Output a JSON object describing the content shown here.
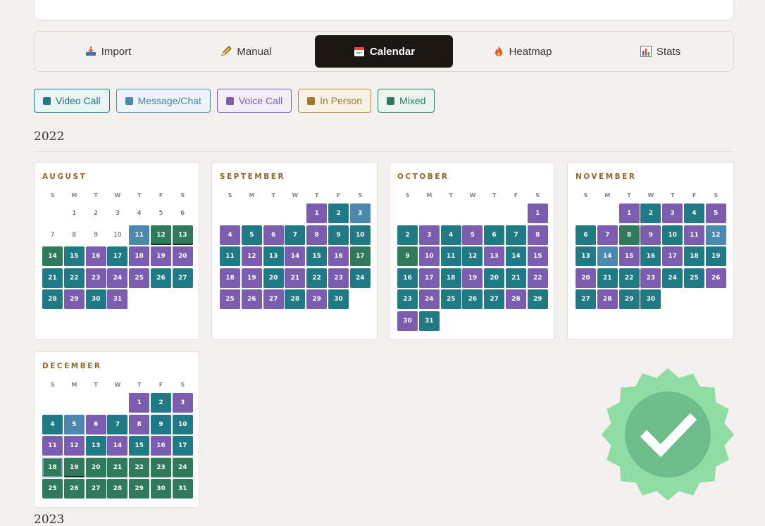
{
  "tabs": [
    {
      "label": "Import",
      "icon": "inbox-tray-icon"
    },
    {
      "label": "Manual",
      "icon": "pencil-icon"
    },
    {
      "label": "Calendar",
      "icon": "calendar-icon",
      "active": true
    },
    {
      "label": "Heatmap",
      "icon": "fire-icon"
    },
    {
      "label": "Stats",
      "icon": "bar-chart-icon"
    }
  ],
  "legend": [
    {
      "label": "Video Call",
      "color": "#1f7a85",
      "text": "#1f6e78",
      "bg": "#e9f4f5",
      "border": "#1f7a85"
    },
    {
      "label": "Message/Chat",
      "color": "#4a88ad",
      "text": "#4a82a6",
      "bg": "#edf3f8",
      "border": "#4a88ad"
    },
    {
      "label": "Voice Call",
      "color": "#7b5cae",
      "text": "#7b5cae",
      "bg": "#f3eef8",
      "border": "#7b5cae"
    },
    {
      "label": "In Person",
      "color": "#a07a2c",
      "text": "#a07a2c",
      "bg": "#f8f2e6",
      "border": "#b08a3c"
    },
    {
      "label": "Mixed",
      "color": "#2e7a5a",
      "text": "#2e7a5a",
      "bg": "#ebf5ef",
      "border": "#2e7a5a"
    }
  ],
  "colors": {
    "V": "#1f7a85",
    "C": "#4a88ad",
    "P": "#7b5cae",
    "M": "#2e7a5a"
  },
  "weekdays": [
    "S",
    "M",
    "T",
    "W",
    "T",
    "F",
    "S"
  ],
  "years": [
    "2022",
    "2023"
  ],
  "months": [
    {
      "name": "AUGUST",
      "start": 1,
      "days": 31,
      "types": "--------------------------------------------------------------------------------------------------------------"
    },
    {
      "name": "SEPTEMBER",
      "start": 4
    },
    {
      "name": "OCTOBER",
      "start": 6
    },
    {
      "name": "NOVEMBER",
      "start": 2
    },
    {
      "name": "DECEMBER",
      "start": 4
    }
  ],
  "month_types": {
    "AUGUST": "----------CMMMVPVPPPVVPPPVVVPVPV",
    "SEPTEMBER": "PVCPVPVPVVVPVPVPMPPVPVPVPPPVPV",
    "OCTOBER": "PVPVPVVPMPVVPVPVPVPVVPVPVVVPVPV",
    "NOVEMBER": "PVPVPVPMPVPCVCPVPVVPVVPVVPVPVV",
    "DECEMBER": "PVPVCPVPVVPPVPVPVMMMMMMMMMMMMMM"
  },
  "month_days": {
    "AUGUST": 31,
    "SEPTEMBER": 30,
    "OCTOBER": 31,
    "NOVEMBER": 30,
    "DECEMBER": 31
  }
}
